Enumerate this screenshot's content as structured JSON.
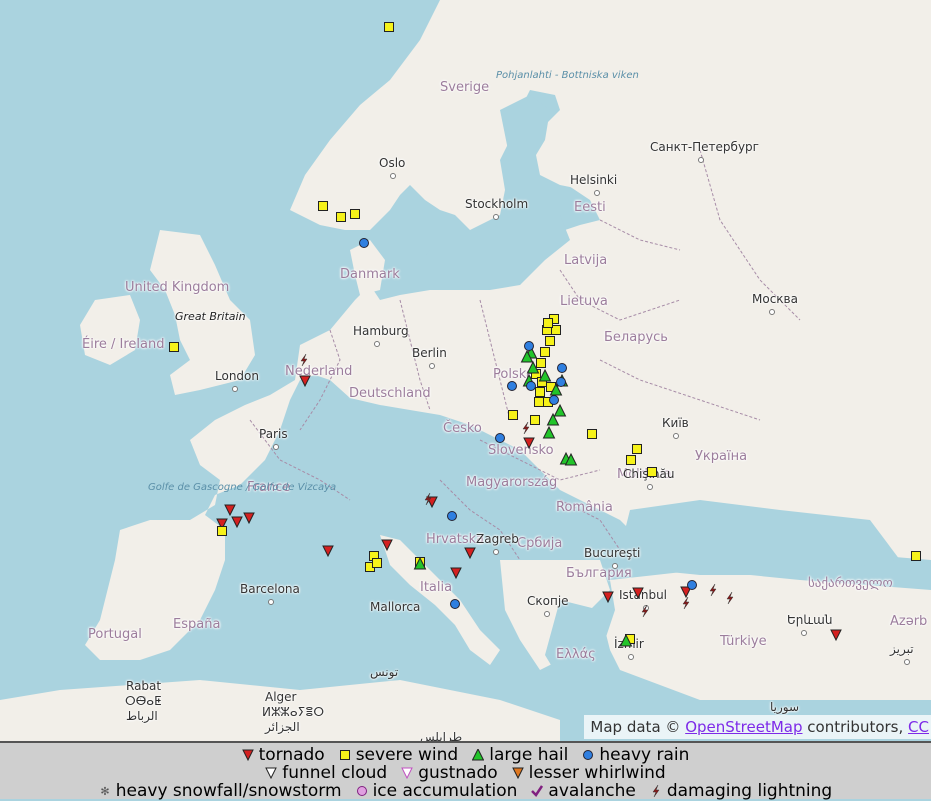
{
  "map": {
    "countries": [
      "Sverige",
      "Danmark",
      "United Kingdom",
      "Éire / Ireland",
      "Nederland",
      "Deutschland",
      "France",
      "España",
      "Portugal",
      "Italia",
      "Česko",
      "Polska",
      "Lietuva",
      "Latvija",
      "Eesti",
      "Беларусь",
      "Україна",
      "Magyarország",
      "Hrvatska",
      "Србија",
      "România",
      "България",
      "Ελλάς",
      "Türkiye",
      "საქართველო",
      "Azərb",
      "Slovensko",
      "Moldova"
    ],
    "cities": [
      "Oslo",
      "Stockholm",
      "Helsinki",
      "Санкт-Петербург",
      "Москва",
      "Hamburg",
      "Berlin",
      "London",
      "Paris",
      "Zagreb",
      "Київ",
      "Chişinău",
      "Bucureşti",
      "Istanbul",
      "İzmir",
      "Скопје",
      "Barcelona",
      "Rabat",
      "Alger",
      "Երևան",
      "تبريز",
      "Mallorca"
    ],
    "water": [
      "Pohjanlahti - Bottniska viken",
      "Golfe de Gascogne / Golfo de Vizcaya"
    ],
    "islands": [
      "Great Britain"
    ],
    "other_labels": [
      "ⵔⴱⴰⵟ",
      "الرباط",
      "ⵍⵣⵣⴰⵢⴻⵔ",
      "الجزائر",
      "تونس",
      "طرابلس",
      "سوريا"
    ]
  },
  "reports": {
    "tornado": [
      [
        305,
        381
      ],
      [
        230,
        510
      ],
      [
        237,
        522
      ],
      [
        249,
        518
      ],
      [
        222,
        524
      ],
      [
        328,
        551
      ],
      [
        387,
        545
      ],
      [
        456,
        573
      ],
      [
        470,
        553
      ],
      [
        608,
        597
      ],
      [
        638,
        593
      ],
      [
        686,
        592
      ],
      [
        836,
        635
      ],
      [
        529,
        443
      ],
      [
        432,
        502
      ]
    ],
    "severe_wind": [
      [
        389,
        27
      ],
      [
        323,
        206
      ],
      [
        341,
        217
      ],
      [
        355,
        214
      ],
      [
        174,
        347
      ],
      [
        222,
        531
      ],
      [
        374,
        556
      ],
      [
        370,
        567
      ],
      [
        377,
        563
      ],
      [
        420,
        562
      ],
      [
        513,
        415
      ],
      [
        592,
        434
      ],
      [
        637,
        449
      ],
      [
        631,
        460
      ],
      [
        652,
        472
      ],
      [
        916,
        556
      ],
      [
        630,
        639
      ],
      [
        554,
        319
      ],
      [
        547,
        330
      ],
      [
        550,
        341
      ],
      [
        545,
        352
      ],
      [
        541,
        363
      ],
      [
        536,
        374
      ],
      [
        542,
        382
      ],
      [
        540,
        392
      ],
      [
        551,
        387
      ],
      [
        539,
        402
      ],
      [
        548,
        402
      ],
      [
        535,
        420
      ],
      [
        556,
        330
      ],
      [
        548,
        323
      ]
    ],
    "large_hail": [
      [
        531,
        353
      ],
      [
        533,
        368
      ],
      [
        529,
        381
      ],
      [
        545,
        376
      ],
      [
        556,
        390
      ],
      [
        562,
        381
      ],
      [
        553,
        420
      ],
      [
        560,
        411
      ],
      [
        549,
        433
      ],
      [
        566,
        459
      ],
      [
        571,
        460
      ],
      [
        527,
        357
      ],
      [
        420,
        564
      ],
      [
        626,
        641
      ]
    ],
    "heavy_rain": [
      [
        364,
        243
      ],
      [
        529,
        346
      ],
      [
        512,
        386
      ],
      [
        531,
        386
      ],
      [
        561,
        382
      ],
      [
        554,
        400
      ],
      [
        500,
        438
      ],
      [
        452,
        516
      ],
      [
        455,
        604
      ],
      [
        692,
        585
      ],
      [
        562,
        368
      ]
    ],
    "damaging_lightning": [
      [
        304,
        360
      ],
      [
        428,
        499
      ],
      [
        526,
        428
      ],
      [
        645,
        611
      ],
      [
        686,
        603
      ],
      [
        713,
        590
      ],
      [
        730,
        598
      ]
    ]
  },
  "attribution": {
    "prefix": "Map data ©",
    "link": "OpenStreetMap",
    "suffix": "contributors,",
    "cc": "CC"
  },
  "legend": {
    "row1": [
      {
        "label": "tornado",
        "symbol": "tornado"
      },
      {
        "label": "severe wind",
        "symbol": "severe_wind"
      },
      {
        "label": "large hail",
        "symbol": "large_hail"
      },
      {
        "label": "heavy rain",
        "symbol": "heavy_rain"
      }
    ],
    "row2": [
      {
        "label": "funnel cloud",
        "symbol": "funnel_cloud"
      },
      {
        "label": "gustnado",
        "symbol": "gustnado"
      },
      {
        "label": "lesser whirlwind",
        "symbol": "lesser_whirlwind"
      }
    ],
    "row3": [
      {
        "label": "heavy snowfall/snowstorm",
        "symbol": "snow"
      },
      {
        "label": "ice accumulation",
        "symbol": "ice"
      },
      {
        "label": "avalanche",
        "symbol": "avalanche"
      },
      {
        "label": "damaging lightning",
        "symbol": "lightning"
      }
    ]
  },
  "colors": {
    "tornado": "#d42020",
    "severe_wind": "#f6f21a",
    "large_hail": "#22c42a",
    "heavy_rain": "#2f7fe0",
    "gustnado": "#c050c0",
    "lesser_whirlwind": "#e07820",
    "land": "#f2efe9",
    "sea": "#aad3df",
    "border": "#a78ca7"
  }
}
